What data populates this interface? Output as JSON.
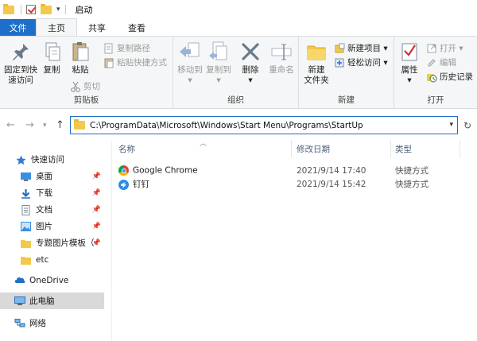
{
  "window": {
    "title": "启动"
  },
  "tabs": [
    {
      "label": "文件"
    },
    {
      "label": "主页"
    },
    {
      "label": "共享"
    },
    {
      "label": "查看"
    }
  ],
  "ribbon": {
    "clipboard": {
      "label": "剪贴板",
      "pin_to_quick_access": "固定到快\n速访问",
      "copy": "复制",
      "paste": "粘贴",
      "copy_path": "复制路径",
      "paste_shortcut": "粘贴快捷方式",
      "cut": "剪切"
    },
    "organize": {
      "label": "组织",
      "move_to": "移动到",
      "copy_to": "复制到",
      "delete": "删除",
      "rename": "重命名"
    },
    "new": {
      "label": "新建",
      "new_folder": "新建\n文件夹",
      "new_item": "新建项目",
      "easy_access": "轻松访问"
    },
    "open": {
      "label": "打开",
      "properties": "属性",
      "open": "打开",
      "edit": "编辑",
      "history": "历史记录"
    }
  },
  "address": {
    "path": "C:\\ProgramData\\Microsoft\\Windows\\Start Menu\\Programs\\StartUp"
  },
  "nav_pane": {
    "items": [
      {
        "label": "快速访问",
        "icon": "star-icon"
      },
      {
        "label": "桌面",
        "icon": "desktop-icon"
      },
      {
        "label": "下载",
        "icon": "download-icon"
      },
      {
        "label": "文档",
        "icon": "document-icon"
      },
      {
        "label": "图片",
        "icon": "pictures-icon"
      },
      {
        "label": "专题图片模板（",
        "icon": "folder-icon"
      },
      {
        "label": "etc",
        "icon": "folder-icon"
      },
      {
        "label": "OneDrive",
        "icon": "onedrive-icon"
      },
      {
        "label": "此电脑",
        "icon": "this-pc-icon"
      },
      {
        "label": "网络",
        "icon": "network-icon"
      }
    ]
  },
  "file_list": {
    "columns": [
      "名称",
      "修改日期",
      "类型"
    ],
    "rows": [
      {
        "name": "Google Chrome",
        "modified": "2021/9/14 17:40",
        "type": "快捷方式",
        "icon": "chrome-icon"
      },
      {
        "name": "钉钉",
        "modified": "2021/9/14 15:42",
        "type": "快捷方式",
        "icon": "dingtalk-icon"
      }
    ]
  },
  "colors": {
    "accent": "#1e6fc8",
    "ribbon_bg": "#f5f6f7",
    "folder": "#f3c94b",
    "selected_nav": "#d9d9d9"
  }
}
